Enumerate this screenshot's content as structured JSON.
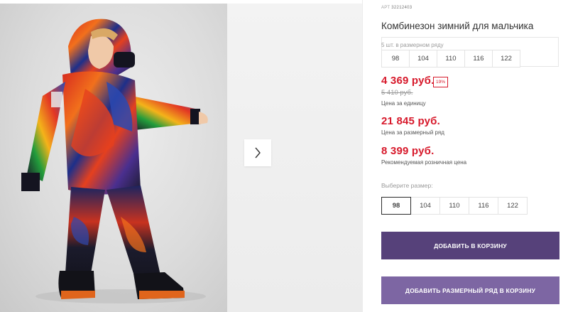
{
  "product": {
    "sku_label": "АРТ",
    "sku": "32212403",
    "title": "Комбинезон зимний для мальчика"
  },
  "pack": {
    "label": "5 шт. в размерном ряду",
    "sizes": [
      "98",
      "104",
      "110",
      "116",
      "122"
    ]
  },
  "prices": {
    "unit": "4 369 руб.",
    "discount": "19%",
    "old_unit": "5 410 руб.",
    "unit_caption": "Цена за единицу",
    "pack": "21 845 руб.",
    "pack_caption": "Цена за размерный ряд",
    "retail": "8 399 руб.",
    "retail_caption": "Рекомендуемая розничная цена"
  },
  "size_select": {
    "label": "Выберите размер:",
    "sizes": [
      "98",
      "104",
      "110",
      "116",
      "122"
    ],
    "selected": "98"
  },
  "actions": {
    "add_to_cart": "ДОБАВИТЬ В КОРЗИНУ",
    "add_pack_to_cart": "ДОБАВИТЬ РАЗМЕРНЫЙ РЯД В КОРЗИНУ"
  },
  "icons": {
    "next": "chevron-right-icon"
  },
  "colors": {
    "price_red": "#d7192b",
    "button_primary": "#56417a",
    "button_secondary": "#7d66a3"
  }
}
